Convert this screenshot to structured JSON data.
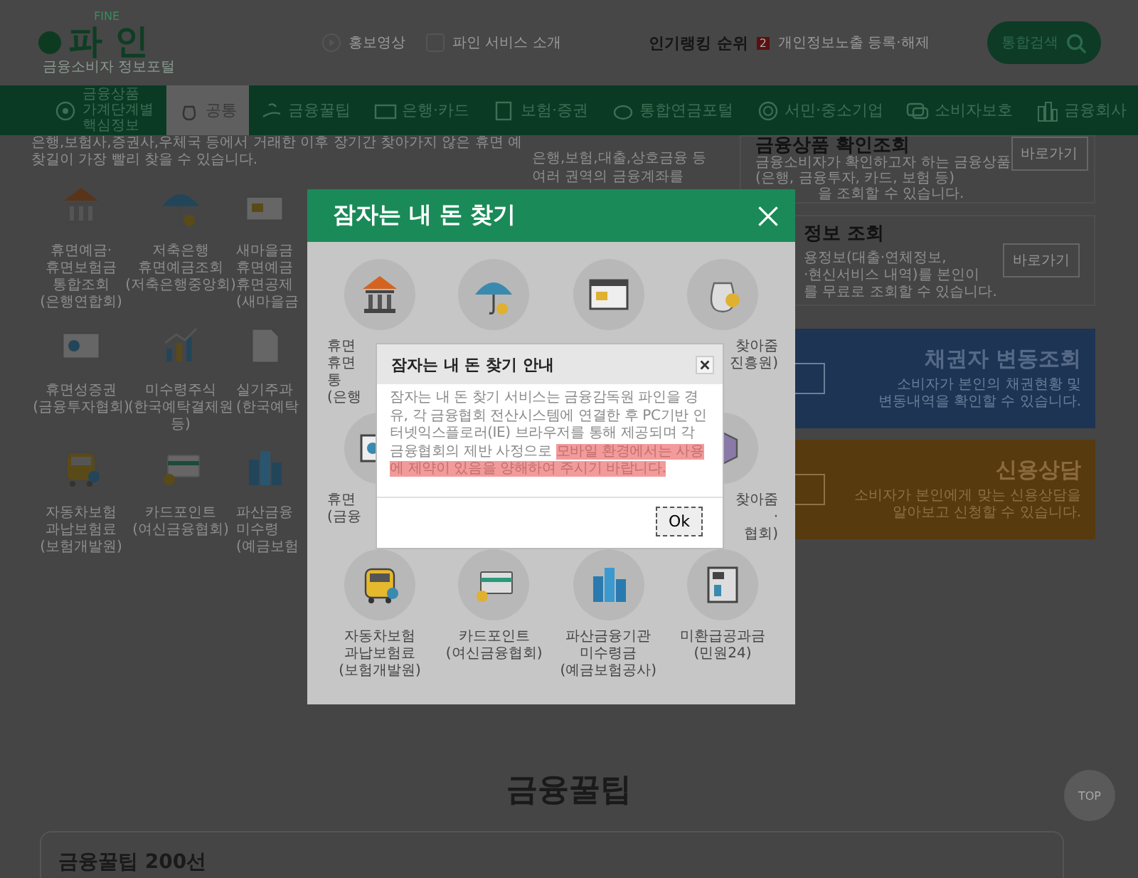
{
  "header": {
    "logo": {
      "eyebrow": "FINE",
      "name": "파 인",
      "tagline": "금융소비자 정보포털"
    },
    "links": [
      "홍보영상",
      "파인 서비스 소개"
    ],
    "ranking": {
      "label": "인기랭킹 순위",
      "rank": "2",
      "item": "개인정보노출 등록·해제"
    },
    "search_button": "통합검색"
  },
  "nav": [
    {
      "label": "금융상품 가계단계별 핵심정보",
      "selected": false
    },
    {
      "label": "공통",
      "selected": true
    },
    {
      "label": "금융꿀팁",
      "selected": false
    },
    {
      "label": "은행·카드",
      "selected": false
    },
    {
      "label": "보험·증권",
      "selected": false
    },
    {
      "label": "통합연금포털",
      "selected": false
    },
    {
      "label": "서민·중소기업",
      "selected": false
    },
    {
      "label": "소비자보호",
      "selected": false
    },
    {
      "label": "금융회사",
      "selected": false
    }
  ],
  "intro": [
    "은행,보험사,증권사,우체국 등에서 거래한 이후 장기간 찾아가지 않은 휴면 예",
    "찾길이 가장 빨리 찾을 수 있습니다."
  ],
  "middle_card": [
    "은행,보험,대출,상호금융 등",
    "여러 권역의 금융계좌를"
  ],
  "services": [
    {
      "lines": [
        "휴면예금·",
        "휴면보험금",
        "통합조회",
        "(은행연합회)"
      ]
    },
    {
      "lines": [
        "저축은행",
        "휴면예금조회",
        "(저축은행중앙회)"
      ]
    },
    {
      "kind": "covered_right",
      "lines": [
        "새마을금",
        "휴면예금",
        "휴면공제",
        "(새마을금"
      ]
    },
    {
      "lines": [
        "휴면성증권",
        "(금융투자협회)"
      ]
    },
    {
      "lines": [
        "미수령주식",
        "(한국예탁결제원",
        "등)"
      ]
    },
    {
      "kind": "covered_right",
      "lines": [
        "실기주과",
        "(한국예탁"
      ]
    },
    {
      "lines": [
        "자동차보험",
        "과납보험료",
        "(보험개발원)"
      ]
    },
    {
      "lines": [
        "카드포인트",
        "(여신금융협회)"
      ]
    },
    {
      "kind": "covered_right",
      "lines": [
        "파산금융",
        "미수령",
        "(예금보험"
      ]
    }
  ],
  "side_cards": [
    {
      "kind": "plain",
      "title": "금융상품 확인조회",
      "lines": [
        {
          "text": "금융소비자가 확인하고자 하는 금융상품",
          "covered": false
        },
        {
          "text": "(은행, 금융투자, 카드, 보험 등)",
          "covered": false
        },
        {
          "text": "을 조회할 수 있습니다.",
          "covered": true
        }
      ],
      "button": "바로가기"
    },
    {
      "kind": "plain",
      "title": "정보 조회",
      "lines": [
        {
          "text": "용정보(대출·연체정보,",
          "covered": true
        },
        {
          "text": "·현신서비스 내역)를 본인이",
          "covered": true
        },
        {
          "text": "를 무료로 조회할 수 있습니다.",
          "covered": true
        }
      ],
      "button": "바로가기"
    },
    {
      "kind": "blue",
      "title": "채권자 변동조회",
      "lines": [
        {
          "text": "소비자가 본인의 채권현황 및",
          "covered": false
        },
        {
          "text": "변동내역을 확인할 수 있습니다.",
          "covered": false
        }
      ]
    },
    {
      "kind": "brown",
      "title": "신용상담",
      "lines": [
        {
          "text": "소비자가 본인에게 맞는 신용상담을",
          "covered": false
        },
        {
          "text": "알아보고 신청할 수 있습니다.",
          "covered": false
        }
      ]
    }
  ],
  "tips": {
    "heading": "금융꿀팁",
    "card_title": "금융꿀팁 200선"
  },
  "top_button": "TOP",
  "modal": {
    "title": "잠자는 내 돈 찾기",
    "rows": [
      {
        "items": [
          {
            "kind": "covered_right",
            "lines": [
              "휴면",
              "휴면",
              "통",
              "(은행"
            ]
          },
          {
            "kind": "covered_all"
          },
          {
            "kind": "covered_all"
          },
          {
            "kind": "covered_left",
            "lines": [
              "찾아줌",
              "진흥원)"
            ]
          }
        ]
      },
      {
        "items": [
          {
            "kind": "covered_right",
            "lines": [
              "휴면",
              "(금융"
            ]
          },
          {
            "kind": "covered_left",
            "lines": [
              "찾아줌",
              "·",
              "협회)"
            ]
          }
        ]
      },
      {
        "items": [
          {
            "kind": "full",
            "lines": [
              "자동차보험",
              "과납보험료",
              "(보험개발원)"
            ]
          },
          {
            "kind": "full",
            "lines": [
              "카드포인트",
              "(여신금융협회)"
            ]
          },
          {
            "kind": "full",
            "lines": [
              "파산금융기관",
              "미수령금",
              "(예금보험공사)"
            ]
          },
          {
            "kind": "full",
            "lines": [
              "미환급공과금",
              "(민원24)"
            ]
          }
        ]
      }
    ]
  },
  "dialog": {
    "title": "잠자는 내 돈 찾기 안내",
    "segments": [
      {
        "text": "잠자는 내 돈 찾기 서비스는 금융감독원 파인을 경유, 각 금융협회 전산시스템에 연결한 후 PC기반 인터넷익스플로러(IE) 브라우저를 통해 제공되며 각 금융협회의 제반 사정으로 ",
        "highlighted": false
      },
      {
        "text": "모바일 환경에서는 사용에 제약이 있음을 양해하여 주시기 바랍니다.",
        "highlighted": true
      }
    ],
    "button": "Ok"
  }
}
